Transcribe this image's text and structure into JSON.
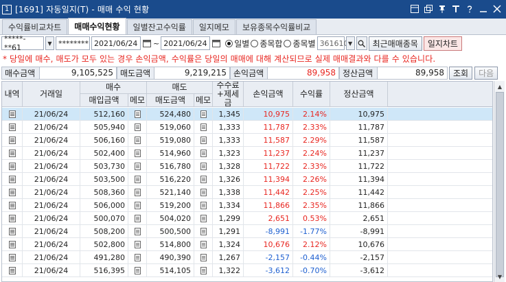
{
  "window": {
    "number": "1",
    "title": "[1691] 자동일지(T) - 매매 수익 현황",
    "icons": [
      "window-restore-icon",
      "window-copy-icon",
      "pin-icon",
      "font-size-icon",
      "help-icon",
      "minimize-icon",
      "close-icon"
    ]
  },
  "tabs": [
    {
      "label": "수익률비교차트",
      "active": false
    },
    {
      "label": "매매수익현황",
      "active": true
    },
    {
      "label": "일별잔고수익률",
      "active": false
    },
    {
      "label": "일지메모",
      "active": false
    },
    {
      "label": "보유종목수익률비교",
      "active": false
    }
  ],
  "toolbar": {
    "account": "*****-**61",
    "password": "********",
    "date_from": "2021/06/24",
    "date_sep": "~",
    "date_to": "2021/06/24",
    "radios": [
      {
        "label": "일별",
        "checked": true
      },
      {
        "label": "종목합",
        "checked": false
      },
      {
        "label": "종목별",
        "checked": false
      }
    ],
    "stock_code": "361610",
    "recent_button": "최근매매종목",
    "chart_button": "일지차트"
  },
  "notice": "* 당일에 매수, 매도가 모두 있는 경우 손익금액, 수익률은 당일의 매매에 대해 계산되므로 실제 매매결과와 다를 수 있습니다.",
  "summary": {
    "buy_label": "매수금액",
    "buy_value": "9,105,525",
    "sell_label": "매도금액",
    "sell_value": "9,219,215",
    "pnl_label": "손익금액",
    "pnl_value": "89,958",
    "settle_label": "정산금액",
    "settle_value": "89,958",
    "query_button": "조회",
    "next_button": "다음"
  },
  "table": {
    "headers": {
      "type": "내역",
      "date": "거래일",
      "buy": "매수",
      "buy_amount": "매입금액",
      "buy_memo": "메모",
      "sell": "매도",
      "sell_amount": "매도금액",
      "sell_memo": "메모",
      "fee": "수수료+제세금",
      "pnl": "손익금액",
      "rate": "수익률",
      "settle": "정산금액"
    },
    "rows": [
      {
        "date": "21/06/24",
        "buy": "512,160",
        "sell": "524,480",
        "fee": "1,345",
        "pnl": "10,975",
        "rate": "2.14%",
        "settle": "10,975",
        "sign": "pos"
      },
      {
        "date": "21/06/24",
        "buy": "505,940",
        "sell": "519,060",
        "fee": "1,333",
        "pnl": "11,787",
        "rate": "2.33%",
        "settle": "11,787",
        "sign": "pos"
      },
      {
        "date": "21/06/24",
        "buy": "506,160",
        "sell": "519,080",
        "fee": "1,333",
        "pnl": "11,587",
        "rate": "2.29%",
        "settle": "11,587",
        "sign": "pos"
      },
      {
        "date": "21/06/24",
        "buy": "502,400",
        "sell": "514,960",
        "fee": "1,323",
        "pnl": "11,237",
        "rate": "2.24%",
        "settle": "11,237",
        "sign": "pos"
      },
      {
        "date": "21/06/24",
        "buy": "503,730",
        "sell": "516,780",
        "fee": "1,328",
        "pnl": "11,722",
        "rate": "2.33%",
        "settle": "11,722",
        "sign": "pos"
      },
      {
        "date": "21/06/24",
        "buy": "503,500",
        "sell": "516,220",
        "fee": "1,326",
        "pnl": "11,394",
        "rate": "2.26%",
        "settle": "11,394",
        "sign": "pos"
      },
      {
        "date": "21/06/24",
        "buy": "508,360",
        "sell": "521,140",
        "fee": "1,338",
        "pnl": "11,442",
        "rate": "2.25%",
        "settle": "11,442",
        "sign": "pos"
      },
      {
        "date": "21/06/24",
        "buy": "506,000",
        "sell": "519,200",
        "fee": "1,334",
        "pnl": "11,866",
        "rate": "2.35%",
        "settle": "11,866",
        "sign": "pos"
      },
      {
        "date": "21/06/24",
        "buy": "500,070",
        "sell": "504,020",
        "fee": "1,299",
        "pnl": "2,651",
        "rate": "0.53%",
        "settle": "2,651",
        "sign": "pos"
      },
      {
        "date": "21/06/24",
        "buy": "508,200",
        "sell": "500,500",
        "fee": "1,291",
        "pnl": "-8,991",
        "rate": "-1.77%",
        "settle": "-8,991",
        "sign": "neg"
      },
      {
        "date": "21/06/24",
        "buy": "502,800",
        "sell": "514,800",
        "fee": "1,324",
        "pnl": "10,676",
        "rate": "2.12%",
        "settle": "10,676",
        "sign": "pos"
      },
      {
        "date": "21/06/24",
        "buy": "491,280",
        "sell": "490,390",
        "fee": "1,267",
        "pnl": "-2,157",
        "rate": "-0.44%",
        "settle": "-2,157",
        "sign": "neg"
      },
      {
        "date": "21/06/24",
        "buy": "516,395",
        "sell": "514,105",
        "fee": "1,322",
        "pnl": "-3,612",
        "rate": "-0.70%",
        "settle": "-3,612",
        "sign": "neg"
      }
    ]
  },
  "colors": {
    "title_bar": "#1a4b8c",
    "positive": "#e8251f",
    "negative": "#1d5fd0",
    "selected_row": "#cfe7f8"
  }
}
